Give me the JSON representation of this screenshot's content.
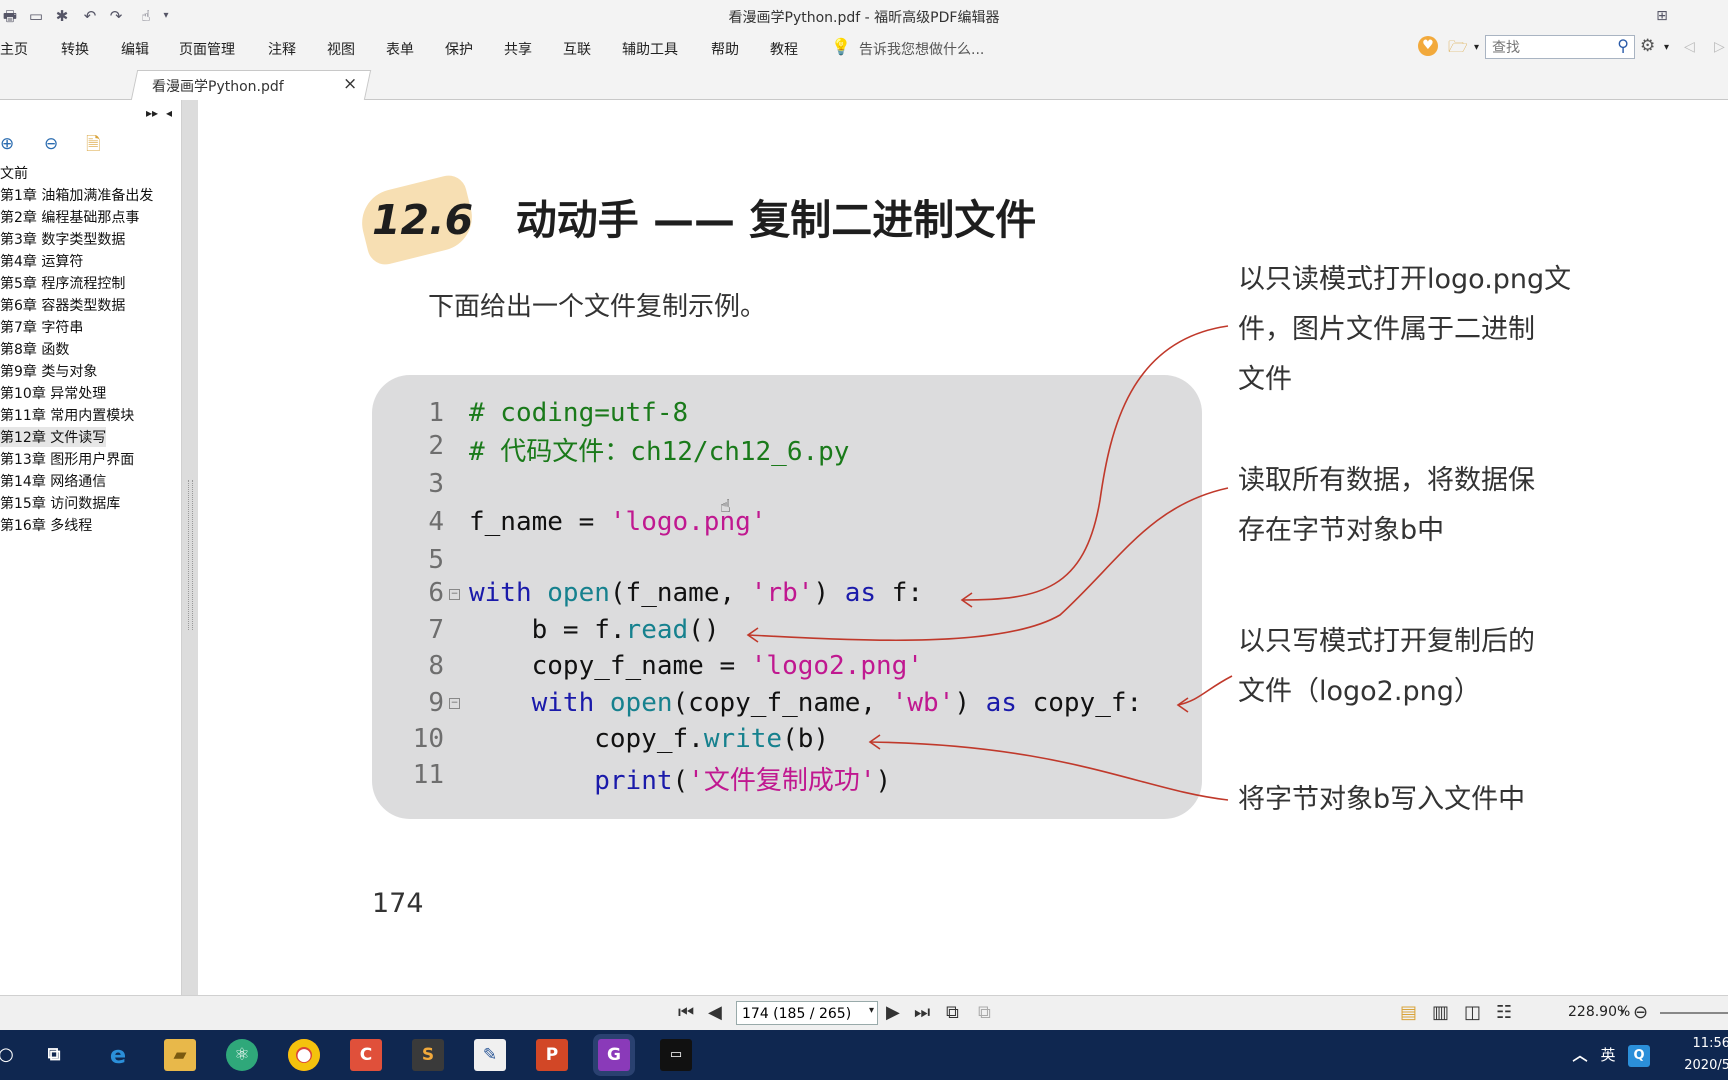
{
  "window": {
    "title": "看漫画学Python.pdf - 福昕高级PDF编辑器"
  },
  "menu": {
    "items": [
      "主页",
      "转换",
      "编辑",
      "页面管理",
      "注释",
      "视图",
      "表单",
      "保护",
      "共享",
      "互联",
      "辅助工具",
      "帮助",
      "教程"
    ],
    "tell_me": "告诉我您想做什么...",
    "search_placeholder": "查找"
  },
  "tab": {
    "label": "看漫画学Python.pdf",
    "close": "×"
  },
  "bookmarks": [
    "文前",
    "第1章 油箱加满准备出发",
    "第2章 编程基础那点事",
    "第3章 数字类型数据",
    "第4章 运算符",
    "第5章 程序流程控制",
    "第6章 容器类型数据",
    "第7章 字符串",
    "第8章 函数",
    "第9章 类与对象",
    "第10章 异常处理",
    "第11章 常用内置模块",
    "第12章 文件读写",
    "第13章 图形用户界面",
    "第14章 网络通信",
    "第15章 访问数据库",
    "第16章 多线程"
  ],
  "selected_bookmark_index": 12,
  "page": {
    "title_number": "12.6",
    "title_text": "动动手 —— 复制二进制文件",
    "intro": "下面给出一个文件复制示例。",
    "code": {
      "line_numbers": [
        "1",
        "2",
        "3",
        "4",
        "5",
        "6",
        "7",
        "8",
        "9",
        "10",
        "11"
      ],
      "l1": "# coding=utf-8",
      "l2": "# 代码文件：ch12/ch12_6.py",
      "l4a": "f_name = ",
      "l4b": "'logo.png'",
      "l6a": "with",
      "l6b": " ",
      "l6c": "open",
      "l6d": "(f_name, ",
      "l6e": "'rb'",
      "l6f": ") ",
      "l6g": "as",
      "l6h": " f:",
      "l7a": "    b = f.",
      "l7b": "read",
      "l7c": "()",
      "l8a": "    copy_f_name = ",
      "l8b": "'logo2.png'",
      "l9a": "    ",
      "l9b": "with",
      "l9c": " ",
      "l9d": "open",
      "l9e": "(copy_f_name, ",
      "l9f": "'wb'",
      "l9g": ") ",
      "l9h": "as",
      "l9i": " copy_f:",
      "l10a": "        copy_f.",
      "l10b": "write",
      "l10c": "(b)",
      "l11a": "        ",
      "l11b": "print",
      "l11c": "(",
      "l11d": "'文件复制成功'",
      "l11e": ")"
    },
    "annotations": [
      [
        "以只读模式打开logo.png文",
        "件，图片文件属于二进制",
        "文件"
      ],
      [
        "读取所有数据，将数据保",
        "存在字节对象b中"
      ],
      [
        "以只写模式打开复制后的",
        "文件（logo2.png）"
      ],
      [
        "将字节对象b写入文件中"
      ]
    ],
    "page_number": "174"
  },
  "status": {
    "page_input": "174 (185 / 265)",
    "zoom": "228.90%"
  },
  "taskbar": {
    "time": "11:56",
    "date": "2020/5",
    "ime": "英"
  },
  "colors": {
    "accent_annotation": "#c0392b",
    "comment": "#1a7a1a",
    "keyword": "#1a1aaa",
    "string": "#c01890",
    "builtin": "#16818e",
    "taskbar": "#0f2750"
  }
}
